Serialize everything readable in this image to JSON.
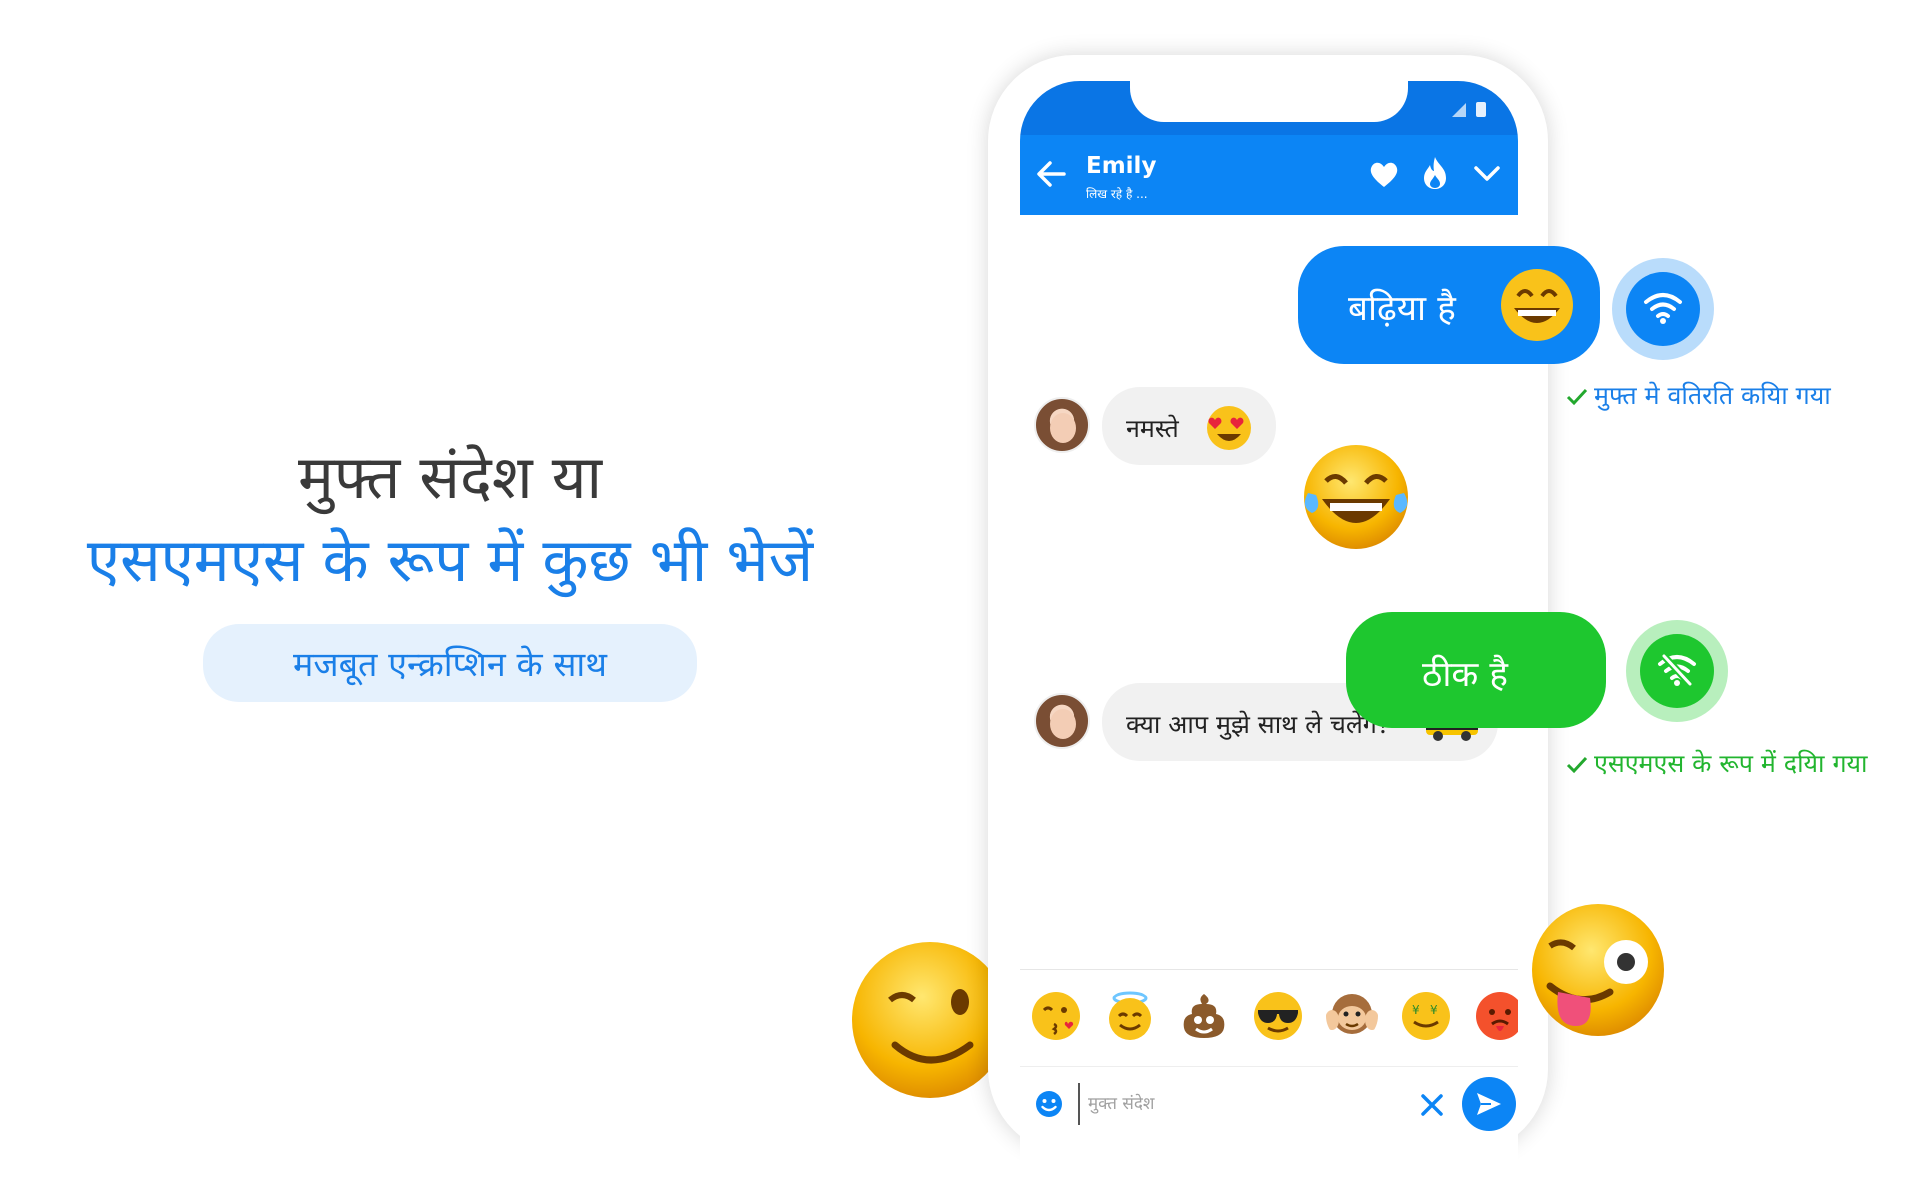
{
  "promo": {
    "line1": "मुफ्त संदेश या",
    "line2": "एसएमएस के रूप में कुछ भी भेजें",
    "pill": "मजबूत एन्क्रप्शिन के साथ"
  },
  "chat": {
    "contact_name": "Emily",
    "contact_status": "लिख रहे है ...",
    "messages": [
      {
        "direction": "out",
        "text": "बढ़िया है",
        "transport": "wifi",
        "status": "मुफ्त मे वतिरति कयिा गया"
      },
      {
        "direction": "in",
        "text": "नमस्ते"
      },
      {
        "direction": "out",
        "emoji": "laughing-tears"
      },
      {
        "direction": "out",
        "text": "ठीक है",
        "transport": "sms",
        "status": "एसएमएस के रूप में दयिा गया"
      },
      {
        "direction": "in",
        "text": "क्या आप मुझे साथ ले चलेगे?"
      }
    ]
  },
  "input": {
    "placeholder": "मुक्त संदेश"
  },
  "colors": {
    "appbar": "#0c85f5",
    "wifi_bubble": "#0c85f5",
    "sms_bubble": "#1ec72f",
    "accent_blue": "#1a7fe8",
    "accent_green": "#22b52f"
  },
  "emoji_tray": [
    "kissing-heart",
    "halo-smile",
    "poop",
    "sunglasses",
    "monkey-hear-no-evil",
    "money-tongue",
    "angry-red"
  ]
}
